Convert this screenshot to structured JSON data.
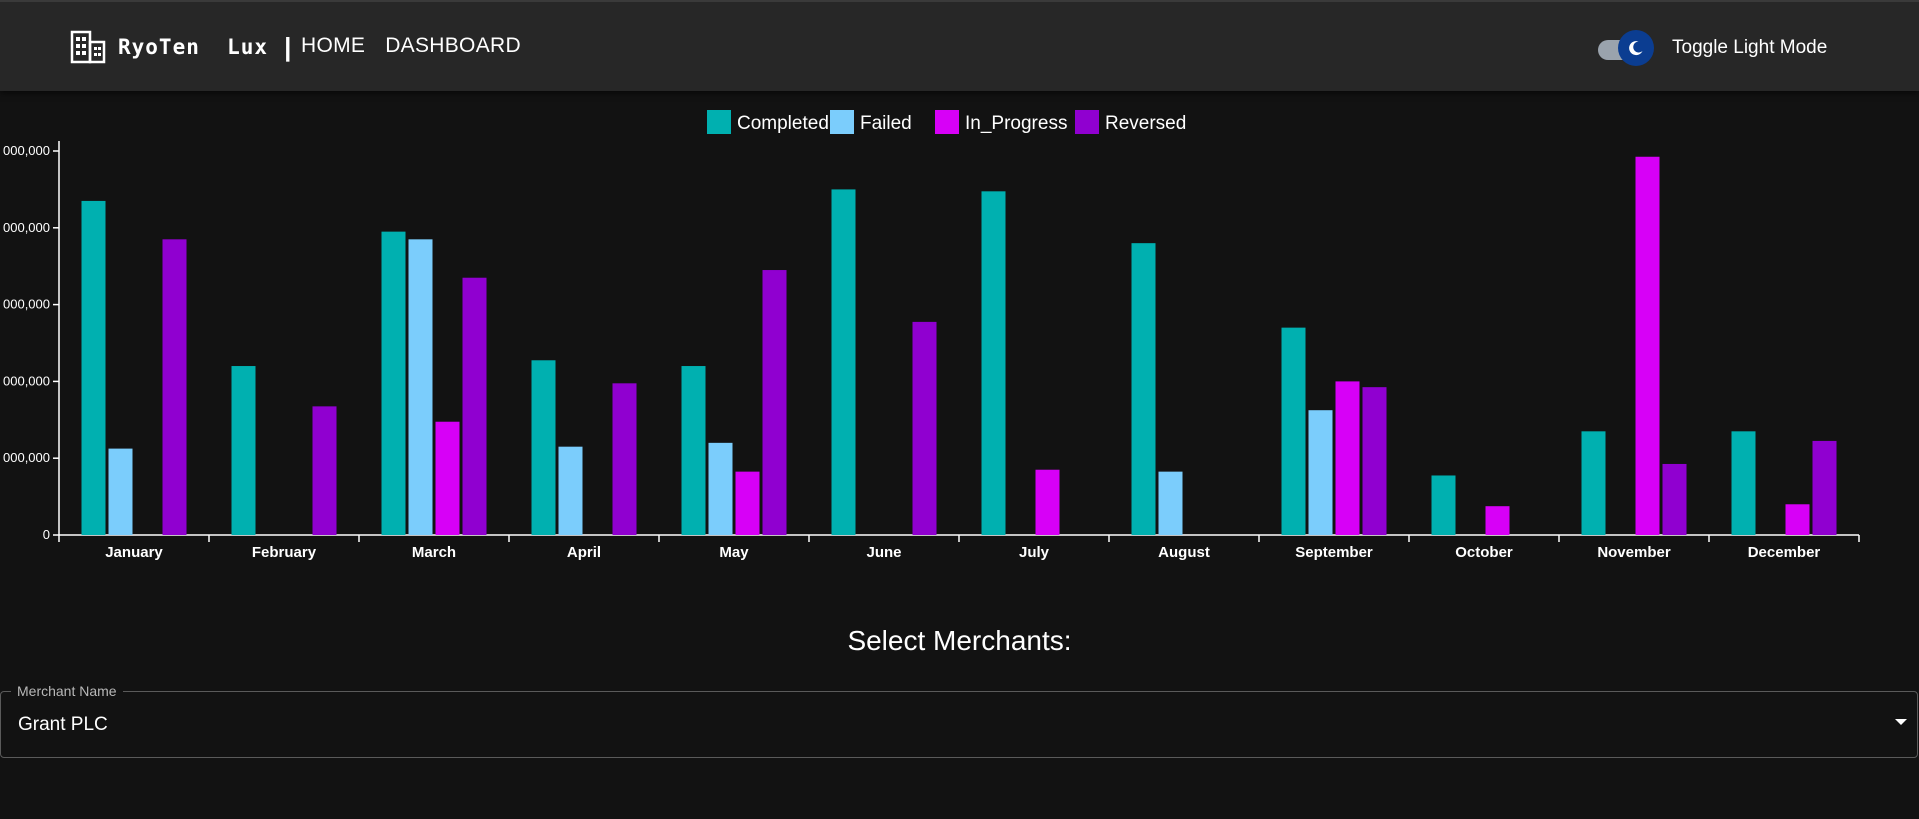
{
  "header": {
    "brand_name": "RyoTen  Lux",
    "brand_separator": "|",
    "nav": [
      {
        "label": "HOME"
      },
      {
        "label": "DASHBOARD"
      }
    ],
    "toggle_label": "Toggle Light Mode",
    "toggle_on": true
  },
  "icons": {
    "brand": "building-icon",
    "theme_toggle": "moon-icon",
    "select": "caret-down-icon"
  },
  "colors": {
    "background": "#121212",
    "appbar": "#272727",
    "Completed": "#00b0b0",
    "Failed": "#7bcdfc",
    "In_Progress": "#d700f7",
    "Reversed": "#9000d0",
    "toggle_thumb": "#0b3d91"
  },
  "chart_data": {
    "type": "bar",
    "legend_position": "top-center",
    "categories": [
      "January",
      "February",
      "March",
      "April",
      "May",
      "June",
      "July",
      "August",
      "September",
      "October",
      "November",
      "December"
    ],
    "series": [
      {
        "name": "Completed",
        "values": [
          8700000,
          4400000,
          7900000,
          4550000,
          4400000,
          9000000,
          8950000,
          7600000,
          5400000,
          1550000,
          2700000,
          2700000
        ]
      },
      {
        "name": "Failed",
        "values": [
          2250000,
          0,
          7700000,
          2300000,
          2400000,
          0,
          0,
          1650000,
          3250000,
          0,
          0,
          0
        ]
      },
      {
        "name": "In_Progress",
        "values": [
          0,
          0,
          2950000,
          0,
          1650000,
          0,
          1700000,
          0,
          4000000,
          750000,
          9850000,
          800000
        ]
      },
      {
        "name": "Reversed",
        "values": [
          7700000,
          3350000,
          6700000,
          3950000,
          6900000,
          5550000,
          0,
          0,
          3850000,
          0,
          1850000,
          2450000
        ]
      }
    ],
    "ylim": [
      0,
      10000000
    ],
    "y_ticks": [
      0,
      2000000,
      4000000,
      6000000,
      8000000,
      10000000
    ],
    "y_tick_labels": [
      "0",
      "000,000",
      "000,000",
      "000,000",
      "000,000",
      "000,000"
    ],
    "grid": false,
    "title": "",
    "xlabel": "",
    "ylabel": ""
  },
  "merchant_select": {
    "title": "Select Merchants:",
    "label": "Merchant Name",
    "value": "Grant PLC"
  }
}
